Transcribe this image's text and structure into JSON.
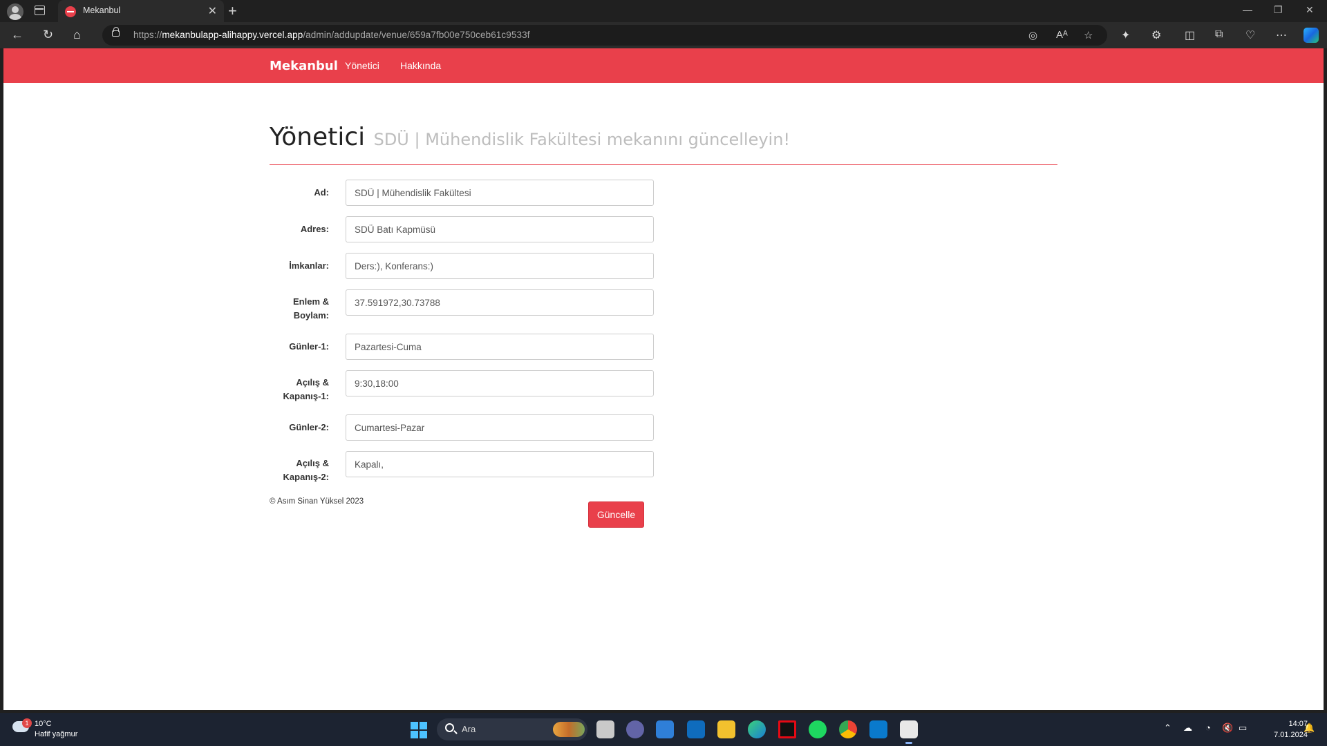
{
  "browser": {
    "tab_title": "Mekanbul",
    "tab_close": "✕",
    "new_tab": "+",
    "url_scheme": "https://",
    "url_host": "mekanbulapp-alihappy.vercel.app",
    "url_path": "/admin/addupdate/venue/659a7fb00e750ceb61c9533f",
    "window_controls": {
      "minimize": "—",
      "restore": "❐",
      "close": "✕"
    }
  },
  "site": {
    "brand": "Mekanbul",
    "nav": [
      "Yönetici",
      "Hakkında"
    ],
    "accent_color": "#e9404b"
  },
  "page": {
    "title": "Yönetici",
    "subtitle": "SDÜ | Mühendislik Fakültesi mekanını güncelleyin!"
  },
  "form": {
    "fields": [
      {
        "label": "Ad:",
        "value": "SDÜ | Mühendislik Fakültesi"
      },
      {
        "label": "Adres:",
        "value": "SDÜ Batı Kapmüsü"
      },
      {
        "label": "İmkanlar:",
        "value": "Ders:), Konferans:)"
      },
      {
        "label_line1": "Enlem &",
        "label_line2": "Boylam:",
        "value": "37.591972,30.73788"
      },
      {
        "label": "Günler-1:",
        "value": "Pazartesi-Cuma"
      },
      {
        "label_line1": "Açılış &",
        "label_line2": "Kapanış-1:",
        "value": "9:30,18:00"
      },
      {
        "label": "Günler-2:",
        "value": "Cumartesi-Pazar"
      },
      {
        "label_line1": "Açılış &",
        "label_line2": "Kapanış-2:",
        "value": "Kapalı,"
      }
    ],
    "submit_label": "Güncelle"
  },
  "footer": {
    "text": "© Asım Sinan Yüksel 2023"
  },
  "taskbar": {
    "weather_badge": "1",
    "weather_temp": "10°C",
    "weather_desc": "Hafif yağmur",
    "search_placeholder": "Ara",
    "apps": [
      "task-view",
      "teams-chat",
      "microsoft-store",
      "outlook",
      "file-explorer",
      "edge",
      "netflix",
      "spotify",
      "chrome",
      "vscode",
      "snipping-tool"
    ],
    "clock_time": "14:07",
    "clock_date": "7.01.2024"
  }
}
